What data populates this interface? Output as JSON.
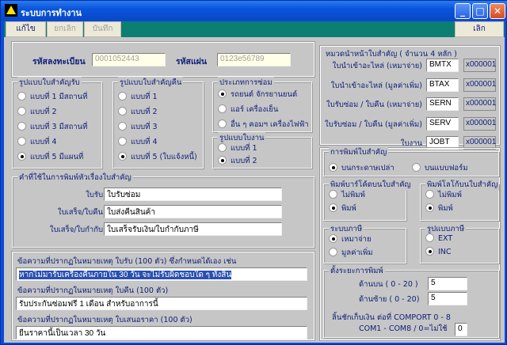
{
  "window": {
    "title": "ระบบการทำงาน",
    "min": "_",
    "max": "□",
    "close": "✕"
  },
  "toolbar": {
    "edit": "แก้ไข",
    "cancel": "ยกเลิก",
    "save": "บันทึก",
    "exit": "เลิก"
  },
  "reg": {
    "reg_label": "รหัสลงทะเบียน",
    "reg_value": "0001052443",
    "key_label": "รหัสแผ่น",
    "key_value": "0123e56789"
  },
  "prefix": {
    "title": "หมวดนำหน้าใบสำคัญ  ( จำนวน 4 หลัก )",
    "rows": [
      {
        "label": "ใบนำเข้าอะไหล่ (เหมาจ่าย)",
        "value": "BMTX",
        "code": "x000001"
      },
      {
        "label": "ใบนำเข้าอะไหล่ (มูลค่าเพิ่ม)",
        "value": "BTAX",
        "code": "x000001"
      },
      {
        "label": "ใบรับซ่อม / ใบคืน (เหมาจ่าย)",
        "value": "SERN",
        "code": "x000001"
      },
      {
        "label": "ใบรับซ่อม / ใบคืน (มูลค่าเพิ่ม)",
        "value": "SERV",
        "code": "x000001"
      },
      {
        "label": "ใบงาน",
        "value": "JOBT",
        "code": "x000001"
      }
    ]
  },
  "receive_format": {
    "title": "รูปแบบใบสำคัญรับ",
    "options": [
      "แบบที่ 1 มีสถานที่",
      "แบบที่ 2",
      "แบบที่ 3 มีสถานที่",
      "แบบที่ 4",
      "แบบที่ 5 มีแผนที่"
    ],
    "selected": 4
  },
  "return_format": {
    "title": "รูปแบบใบสำคัญคืน",
    "options": [
      "แบบที่ 1",
      "แบบที่ 2",
      "แบบที่ 3",
      "แบบที่ 4",
      "แบบที่ 5 (ใบแจ้งหนี้)"
    ],
    "selected": 4
  },
  "repair_type": {
    "title": "ประเภทการซ่อม",
    "options": [
      "รถยนต์ จักรยานยนต์",
      "แอร์ เครื่องเย็น",
      "อื่น ๆ คอมฯ เครื่องไฟฟ้า"
    ],
    "selected": 0
  },
  "job_format": {
    "title": "รูปแบบใบงาน",
    "options": [
      "แบบที่ 1",
      "แบบที่ 2"
    ],
    "selected": 1
  },
  "titles": {
    "title": "คำที่ใช้ในการพิมพ์หัวเรื่องใบสำคัญ",
    "rows": [
      {
        "label": "ใบรับ",
        "value": "ใบรับซ่อม"
      },
      {
        "label": "ใบเสร็จ/ใบคืน",
        "value": "ใบส่งคืนสินค้า"
      },
      {
        "label": "ใบเสร็จ/ใบกำกับ",
        "value": "ใบเสร็จรับเงิน/ใบกำกับภาษี"
      }
    ]
  },
  "notes": [
    {
      "label": "ข้อความที่ปรากฏในหมายเหตุ ใบรับ (100 ตัว) ซึ่งกำหนดได้เอง เช่น",
      "value": "หากไม่มารับเครื่องคืนภายใน 30 วัน จะไม่รับผิดชอบใด ๆ ทั้งสิ้น"
    },
    {
      "label": "ข้อความที่ปรากฏในหมายเหตุ ใบคืน (100 ตัว)",
      "value": "รับประกันซ่อมฟรี 1 เดือน สำหรับอาการนี้"
    },
    {
      "label": "ข้อความที่ปรากฏในหมายเหตุ ใบเสนอราคา (100 ตัว)",
      "value": "ยืนราคานี้เป็นเวลา 30 วัน"
    }
  ],
  "print_doc": {
    "title": "การพิมพ์ใบสำคัญ",
    "options": [
      "บนกระดาษเปล่า",
      "บนแบบฟอร์ม"
    ],
    "selected": 0
  },
  "barcode": {
    "title": "พิมพ์บาร์โค้ดบนใบสำคัญ",
    "options": [
      "ไม่พิมพ์",
      "พิมพ์"
    ],
    "selected": 1
  },
  "logo": {
    "title": "พิมพ์โลโก้บนใบสำคัญ",
    "options": [
      "ไม่พิมพ์",
      "พิมพ์"
    ],
    "selected": 1
  },
  "tax_system": {
    "title": "ระบบภาษี",
    "options": [
      "เหมาจ่าย",
      "มูลค่าเพิ่ม"
    ],
    "selected": 0
  },
  "tax_format": {
    "title": "รูปแบบภาษี",
    "options": [
      "EXT",
      "INC"
    ],
    "selected": 1
  },
  "margins": {
    "title": "ตั้งระยะการพิมพ์",
    "top_label": "ด้านบน ( 0 - 20 )",
    "top_value": "5",
    "left_label": "ด้านซ้าย ( 0 - 20)",
    "left_value": "5",
    "drawer_label": "ลิ้นชักเก็บเงิน ต่อที่ COMPORT 0 - 8",
    "com_label": "COM1 - COM8  / 0=ไม่ใช้",
    "com_value": "0"
  }
}
